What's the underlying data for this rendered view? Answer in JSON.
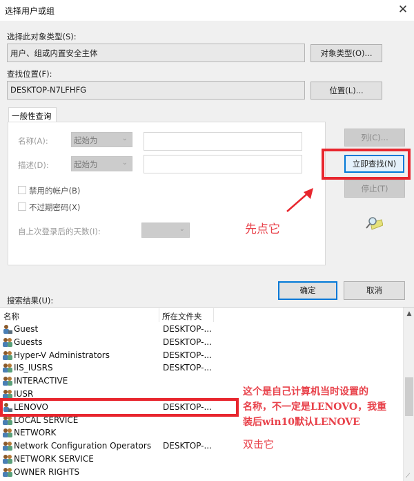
{
  "window": {
    "title": "选择用户或组",
    "close_icon": "close-icon"
  },
  "object_type": {
    "label": "选择此对象类型(S):",
    "value": "用户、组或内置安全主体",
    "button": "对象类型(O)..."
  },
  "location": {
    "label": "查找位置(F):",
    "value": "DESKTOP-N7LFHFG",
    "button": "位置(L)..."
  },
  "query": {
    "tab_label": "一般性查询",
    "name_label": "名称(A):",
    "name_mode": "起始为",
    "name_value": "",
    "desc_label": "描述(D):",
    "desc_mode": "起始为",
    "desc_value": "",
    "disabled_accounts_label": "禁用的帐户(B)",
    "disabled_accounts_checked": false,
    "no_expire_label": "不过期密码(X)",
    "no_expire_checked": false,
    "days_label": "自上次登录后的天数(I):",
    "days_value": ""
  },
  "side_buttons": {
    "columns": "列(C)...",
    "find_now": "立即查找(N)",
    "stop": "停止(T)",
    "search_icon": "find-search-icon"
  },
  "dialog_buttons": {
    "ok": "确定",
    "cancel": "取消"
  },
  "results": {
    "label": "搜索结果(U):",
    "columns": [
      "名称",
      "所在文件夹"
    ],
    "rows": [
      {
        "name": "Guest",
        "folder": "DESKTOP-...",
        "icon": "user-icon"
      },
      {
        "name": "Guests",
        "folder": "DESKTOP-...",
        "icon": "group-icon"
      },
      {
        "name": "Hyper-V Administrators",
        "folder": "DESKTOP-...",
        "icon": "group-icon"
      },
      {
        "name": "IIS_IUSRS",
        "folder": "DESKTOP-...",
        "icon": "group-icon"
      },
      {
        "name": "INTERACTIVE",
        "folder": "",
        "icon": "group-icon"
      },
      {
        "name": "IUSR",
        "folder": "",
        "icon": "group-icon"
      },
      {
        "name": "LENOVO",
        "folder": "DESKTOP-...",
        "icon": "user-icon"
      },
      {
        "name": "LOCAL SERVICE",
        "folder": "",
        "icon": "group-icon"
      },
      {
        "name": "NETWORK",
        "folder": "",
        "icon": "group-icon"
      },
      {
        "name": "Network Configuration Operators",
        "folder": "DESKTOP-...",
        "icon": "group-icon"
      },
      {
        "name": "NETWORK SERVICE",
        "folder": "",
        "icon": "group-icon"
      },
      {
        "name": "OWNER RIGHTS",
        "folder": "",
        "icon": "group-icon"
      }
    ]
  },
  "annotations": {
    "click_first": "先点它",
    "note_line1": "这个是自己计算机当时设置的",
    "note_line2": "名称，不一定是LENOVO，我重",
    "note_line3": "装后win10默认LENOVE",
    "double_click": "双击它",
    "color": "#e8262e"
  }
}
